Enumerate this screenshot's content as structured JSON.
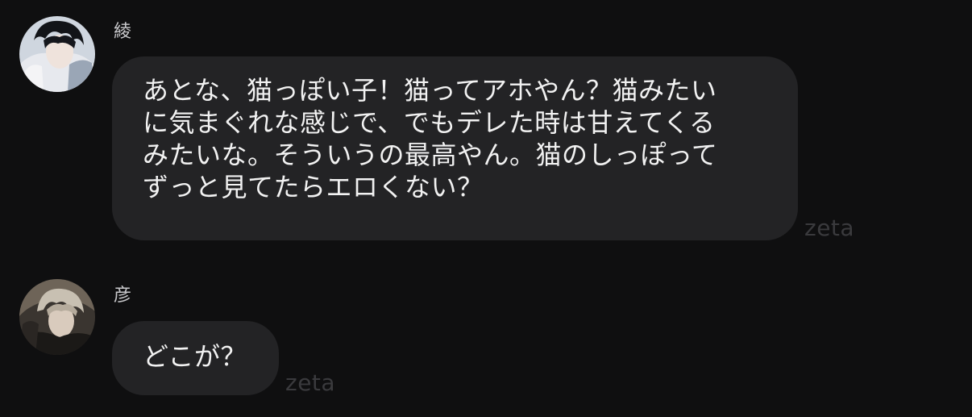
{
  "messages": [
    {
      "sender": "綾",
      "text": "あとな、猫っぽい子！猫ってアホやん？猫みたい\nに気まぐれな感じで、でもデレた時は甘えてくる\nみたいな。そういうの最高やん。猫のしっぽって\nずっと見てたらエロくない？",
      "watermark": "zeta"
    },
    {
      "sender": "彦",
      "text": "どこが？",
      "watermark": "zeta"
    }
  ],
  "colors": {
    "background": "#0f0f10",
    "bubble": "#232325",
    "text": "#f2f2f2",
    "name": "#c9c9cc",
    "watermark": "#3a3a3d"
  }
}
